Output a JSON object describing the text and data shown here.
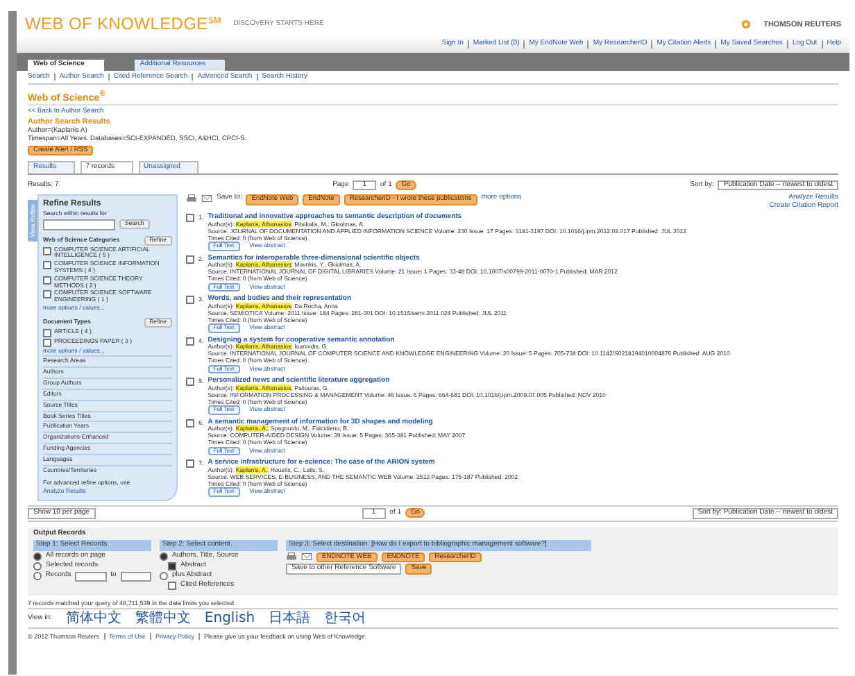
{
  "header": {
    "logo": "WEB OF KNOWLEDGE℠",
    "tagline": "DISCOVERY STARTS HERE",
    "brand": "THOMSON REUTERS"
  },
  "top_links": [
    "Sign In",
    "Marked List (0)",
    "My EndNote Web",
    "My ResearcherID",
    "My Citation Alerts",
    "My Saved Searches",
    "Log Out",
    "Help"
  ],
  "tabs": [
    {
      "label": "Web of Science",
      "selected": true
    },
    {
      "label": "Additional Resources",
      "selected": false
    }
  ],
  "subnav": [
    "Search",
    "Author Search",
    "Cited Reference Search",
    "Advanced Search",
    "Search History"
  ],
  "page_title": "Web of Science$^{®}$",
  "back_link": "<< Back to Author Search",
  "results_heading": "Author Search Results",
  "query_lines": [
    "Author=(Kaplanis A)",
    "Timespan=All Years. Databases=SCI-EXPANDED, SSCI, A&HCI, CPCI-S."
  ],
  "alert_button": "Create Alert / RSS",
  "result_tabs": [
    {
      "label": "Results",
      "selected": false
    },
    {
      "label": "7 records",
      "selected": true
    },
    {
      "label": "Unassigned",
      "selected": false
    }
  ],
  "results_count": "Results: 7",
  "pager": {
    "prefix": "Page",
    "page": "1",
    "of": "of 1",
    "go": "Go"
  },
  "sort": {
    "label": "Sort by:",
    "value": "Publication Date -- newest to oldest"
  },
  "side_links": [
    "Analyze Results",
    "Create Citation Report"
  ],
  "refine": {
    "title": "Refine Results",
    "search_label": "Search within results for",
    "search_button": "Search",
    "side_tab": "View Refine",
    "groups": [
      {
        "title": "Web of Science Categories",
        "button": "Refine",
        "options": [
          {
            "label": "COMPUTER SCIENCE ARTIFICIAL INTELLIGENCE ( 5 )",
            "checked": false
          },
          {
            "label": "COMPUTER SCIENCE INFORMATION SYSTEMS ( 4 )",
            "checked": false
          },
          {
            "label": "COMPUTER SCIENCE THEORY METHODS ( 2 )",
            "checked": false
          },
          {
            "label": "COMPUTER SCIENCE SOFTWARE ENGINEERING ( 1 )",
            "checked": false
          }
        ],
        "more": "more options / values..."
      },
      {
        "title": "Document Types",
        "button": "Refine",
        "options": [
          {
            "label": "ARTICLE ( 4 )",
            "checked": false
          },
          {
            "label": "PROCEEDINGS PAPER ( 3 )",
            "checked": false
          }
        ],
        "more": "more options / values..."
      }
    ],
    "collapsed": [
      "Research Areas",
      "Authors",
      "Group Authors",
      "Editors",
      "Source Titles",
      "Book Series Titles",
      "Publication Years",
      "Organizations-Enhanced",
      "Funding Agencies",
      "Languages",
      "Countries/Territories"
    ],
    "advanced_note": "For advanced refine options, use",
    "analyze": "Analyze Results"
  },
  "toolbar": {
    "save_label": "Save to:",
    "buttons": [
      "EndNote Web",
      "EndNote",
      "ResearcherID - I wrote these publications"
    ],
    "more": "more options"
  },
  "records": [
    {
      "number": "1.",
      "title": "Traditional and innovative approaches to semantic description of documents",
      "authors_prefix": "Author(s):",
      "highlight": "Kaplanis, Athanasios",
      "authors_rest": "; Pitsikalis, M.; Gkiolmas, A.",
      "source": "Source: JOURNAL OF DOCUMENTATION AND APPLIED INFORMATION SCIENCE Volume: 230 Issue: 17 Pages: 3181-3197 DOI: 10.1016/j.ipm.2012.02.017 Published: JUL 2012",
      "cited": "Times Cited: 0 (from Web of Science)",
      "checked": false,
      "full_text": "Full Text",
      "view_abstract": "View abstract"
    },
    {
      "number": "2.",
      "title": "Semantics for interoperable three-dimensional scientific objects",
      "authors_prefix": "Author(s):",
      "highlight": "Kaplanis, Athanasios",
      "authors_rest": "; Mavrikis, Y.; Gkiolmas, A.",
      "source": "Source: INTERNATIONAL JOURNAL OF DIGITAL LIBRARIES Volume: 21 Issue: 1 Pages: 33-48 DOI: 10.1007/s00799-2011-0070-1 Published: MAR 2012",
      "cited": "Times Cited: 0 (from Web of Science)",
      "checked": false,
      "full_text": "Full Text",
      "view_abstract": "View abstract"
    },
    {
      "number": "3.",
      "title": "Words, and bodies and their representation",
      "authors_prefix": "Author(s):",
      "highlight": "Kaplanis, Athanasios",
      "authors_rest": "; Da Rocha, Anna",
      "source": "Source: SEMIOTICA Volume: 2011 Issue: 184 Pages: 281-301 DOI: 10.1515/semi.2011.024 Published: JUL 2011",
      "cited": "Times Cited: 0 (from Web of Science)",
      "checked": false,
      "full_text": "Full Text",
      "view_abstract": "View abstract"
    },
    {
      "number": "4.",
      "title": "Designing a system for cooperative semantic annotation",
      "authors_prefix": "Author(s):",
      "highlight": "Kaplanis, Athanasios",
      "authors_rest": "; Ioannidis, G.",
      "source": "Source: INTERNATIONAL JOURNAL OF COMPUTER SCIENCE AND KNOWLEDGE ENGINEERING Volume: 20 Issue: 5 Pages: 705-738 DOI: 10.1142/S0218194010004876 Published: AUG 2010",
      "cited": "Times Cited: 0 (from Web of Science)",
      "checked": false,
      "full_text": "Full Text",
      "view_abstract": "View abstract"
    },
    {
      "number": "5.",
      "title": "Personalized news and scientific literature aggregation",
      "authors_prefix": "Author(s):",
      "highlight": "Kaplanis, Athanasios",
      "authors_rest": "; Paliouras, G.",
      "source": "Source: INFORMATION PROCESSING & MANAGEMENT Volume: 46 Issue: 6 Pages: 664-681 DOI: 10.1016/j.ipm.2009.07.005 Published: NOV 2010",
      "cited": "Times Cited: 0 (from Web of Science)",
      "checked": false,
      "full_text": "Full Text",
      "view_abstract": "View abstract"
    },
    {
      "number": "6.",
      "title": "A semantic management of information for 3D shapes and modeling",
      "authors_prefix": "Author(s):",
      "highlight": "Kaplanis, A.",
      "authors_rest": "; Spagnuolo, M.; Falcidieno, B.",
      "source": "Source: COMPUTER-AIDED DESIGN Volume: 39 Issue: 5 Pages: 365-381 Published: MAY 2007",
      "cited": "Times Cited: 0 (from Web of Science)",
      "checked": false,
      "full_text": "Full Text",
      "view_abstract": "View abstract"
    },
    {
      "number": "7.",
      "title": "A service infrastructure for e-science: The case of the ARION system",
      "authors_prefix": "Author(s):",
      "highlight": "Kaplanis, A.",
      "authors_rest": "; Houstis, C.; Lalis, S.",
      "source": "Source: WEB SERVICES, E-BUSINESS, AND THE SEMANTIC WEB Volume: 2512 Pages: 175-187 Published: 2002",
      "cited": "Times Cited: 0 (from Web of Science)",
      "checked": false,
      "full_text": "Full Text",
      "view_abstract": "View abstract"
    }
  ],
  "bottom_bar": {
    "show": "Show 10 per page",
    "page": "1",
    "of": "of 1",
    "go": "Go",
    "sort": "Sort by: Publication Date -- newest to oldest"
  },
  "output": {
    "title": "Output Records",
    "steps": [
      {
        "heading": "Step 1: Select Records."
      },
      {
        "heading": "Step 2: Select content."
      },
      {
        "heading": "Step 3: Select destination. [How do I export to bibliographic management software?]"
      }
    ],
    "record_choices": [
      {
        "label": "All records on page",
        "selected": true
      },
      {
        "label": "Selected records",
        "selected": false
      },
      {
        "label": "Records",
        "selected": false
      }
    ],
    "to": "to",
    "content_choices": [
      {
        "label": "Authors, Title, Source",
        "selected": true
      },
      {
        "label": "plus Abstract",
        "selected": false
      }
    ],
    "abstract_check": {
      "label": "Abstract",
      "checked": true
    },
    "cited_check": {
      "label": "Cited References",
      "checked": false
    },
    "dest_buttons": [
      "ENDNOTE WEB",
      "ENDNOTE",
      "ResearcherID"
    ],
    "save_select": "Save to other Reference Software",
    "save_button": "Save"
  },
  "note": "7 records matched your query of 48,711,539 in the data limits you selected.",
  "languages": {
    "label": "View in:",
    "items": [
      "简体中文",
      "繁體中文",
      "English",
      "日本語",
      "한국어"
    ]
  },
  "footer": [
    "© 2012 Thomson Reuters",
    "Terms of Use",
    "Privacy Policy",
    "Please give us your feedback on using Web of Knowledge."
  ]
}
